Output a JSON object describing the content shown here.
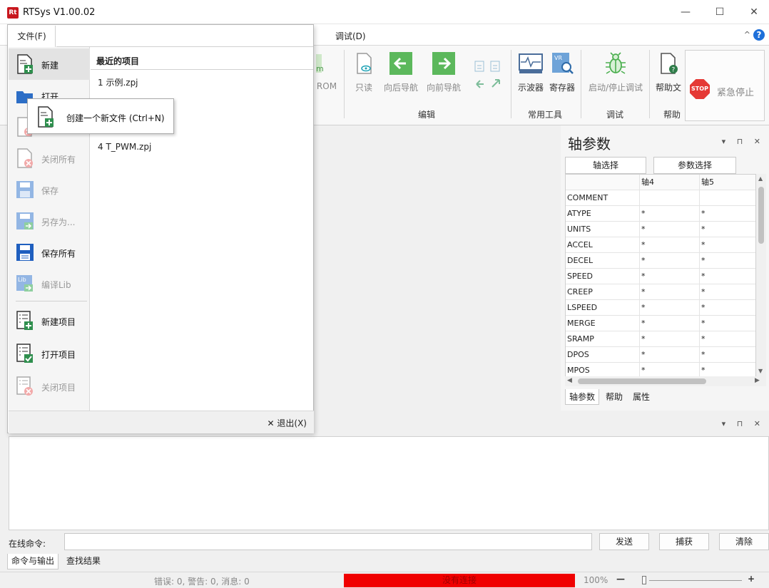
{
  "app": {
    "logo_text": "Rt",
    "title": "RTSys V1.00.02"
  },
  "window_controls": {
    "minimize": "—",
    "maximize": "☐",
    "close": "✕"
  },
  "menubar": {
    "file": "文件(F)",
    "debug": "调试(D)",
    "collapse": "^",
    "help": "?"
  },
  "ribbon": {
    "rom_label": "ROM",
    "readonly": "只读",
    "nav_back": "向后导航",
    "nav_forward": "向前导航",
    "oscilloscope": "示波器",
    "register": "寄存器",
    "start_stop_debug": "启动/停止调试",
    "help_doc": "帮助文",
    "emergency_stop": "紧急停止",
    "stop_sign": "STOP",
    "groups": {
      "edit": "编辑",
      "tools": "常用工具",
      "debug": "调试",
      "help": "帮助"
    }
  },
  "axis_panel": {
    "title": "轴参数",
    "controls": "▾ ⊓ ✕",
    "axis_select": "轴选择",
    "param_select": "参数选择",
    "columns": [
      "",
      "轴4",
      "轴5"
    ],
    "rows": [
      {
        "name": "COMMENT",
        "a4": "",
        "a5": ""
      },
      {
        "name": "ATYPE",
        "a4": "*",
        "a5": "*"
      },
      {
        "name": "UNITS",
        "a4": "*",
        "a5": "*"
      },
      {
        "name": "ACCEL",
        "a4": "*",
        "a5": "*"
      },
      {
        "name": "DECEL",
        "a4": "*",
        "a5": "*"
      },
      {
        "name": "SPEED",
        "a4": "*",
        "a5": "*"
      },
      {
        "name": "CREEP",
        "a4": "*",
        "a5": "*"
      },
      {
        "name": "LSPEED",
        "a4": "*",
        "a5": "*"
      },
      {
        "name": "MERGE",
        "a4": "*",
        "a5": "*"
      },
      {
        "name": "SRAMP",
        "a4": "*",
        "a5": "*"
      },
      {
        "name": "DPOS",
        "a4": "*",
        "a5": "*"
      },
      {
        "name": "MPOS",
        "a4": "*",
        "a5": "*"
      }
    ],
    "tabs": [
      "轴参数",
      "帮助",
      "属性"
    ]
  },
  "output_panel": {
    "controls": "▾ ⊓ ✕",
    "cmd_label": "在线命令:",
    "send": "发送",
    "capture": "捕获",
    "clear": "清除",
    "tabs": [
      "命令与输出",
      "查找结果"
    ]
  },
  "status": {
    "messages": "错误: 0, 警告: 0, 消息: 0",
    "connection": "没有连接",
    "zoom": "100%",
    "zoom_minus": "—",
    "zoom_plus": "+",
    "connection_color": "#f00000"
  },
  "file_menu": {
    "tab": "文件(F)",
    "items": [
      {
        "label": "新建"
      },
      {
        "label": "打开"
      },
      {
        "label": ""
      },
      {
        "label": "关闭所有"
      },
      {
        "label": "保存"
      },
      {
        "label": "另存为..."
      },
      {
        "label": "保存所有"
      },
      {
        "label": "编译Lib"
      },
      {
        "label": "新建项目"
      },
      {
        "label": "打开项目"
      },
      {
        "label": "关闭项目"
      }
    ],
    "recent_title": "最近的项目",
    "recent": [
      "1 示例.zpj",
      "4 T_PWM.zpj"
    ],
    "exit": "✕ 退出(X)"
  },
  "tooltip": {
    "text": "创建一个新文件 (Ctrl+N)"
  }
}
